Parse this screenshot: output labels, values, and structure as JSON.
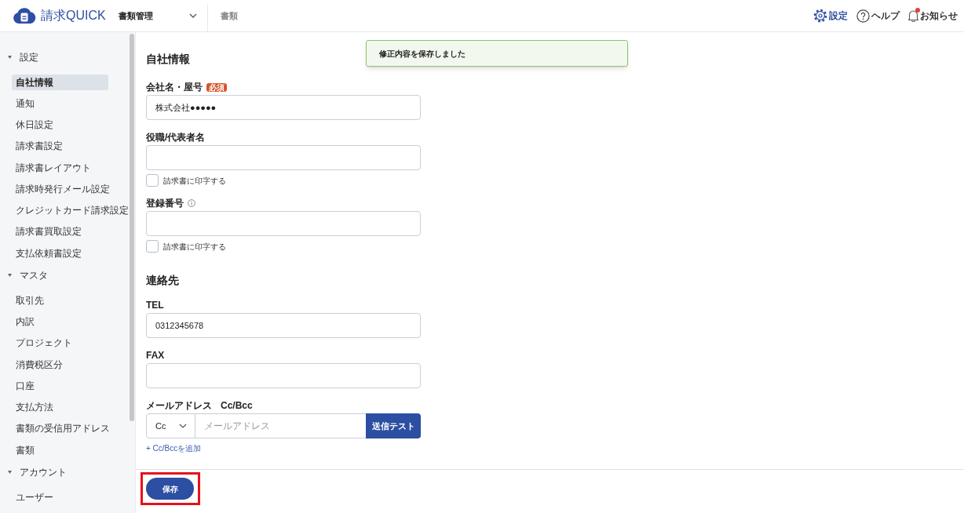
{
  "header": {
    "logo": "請求QUICK",
    "module_select": "書類管理",
    "breadcrumb": "書類",
    "actions": [
      {
        "kind": "settings",
        "label": "設定"
      },
      {
        "kind": "help",
        "label": "ヘルプ"
      },
      {
        "kind": "notifications",
        "label": "お知らせ",
        "unread": true
      }
    ]
  },
  "sidebar": {
    "groups": [
      {
        "label": "設定",
        "expanded": true,
        "items": [
          {
            "label": "自社情報",
            "selected": true
          },
          {
            "label": "通知",
            "selected": false
          },
          {
            "label": "休日設定",
            "selected": false
          },
          {
            "label": "請求書設定",
            "selected": false
          },
          {
            "label": "請求書レイアウト",
            "selected": false
          },
          {
            "label": "請求時発行メール設定",
            "selected": false
          },
          {
            "label": "クレジットカード請求設定",
            "selected": false
          },
          {
            "label": "請求書買取設定",
            "selected": false
          },
          {
            "label": "支払依頼書設定",
            "selected": false
          }
        ]
      },
      {
        "label": "マスタ",
        "expanded": true,
        "items": [
          {
            "label": "取引先",
            "selected": false
          },
          {
            "label": "内訳",
            "selected": false
          },
          {
            "label": "プロジェクト",
            "selected": false
          },
          {
            "label": "消費税区分",
            "selected": false
          },
          {
            "label": "口座",
            "selected": false
          },
          {
            "label": "支払方法",
            "selected": false
          },
          {
            "label": "書類の受信用アドレス",
            "selected": false
          },
          {
            "label": "書類",
            "selected": false
          }
        ]
      },
      {
        "label": "アカウント",
        "expanded": true,
        "items": [
          {
            "label": "ユーザー",
            "selected": false
          }
        ]
      }
    ]
  },
  "toast": {
    "message": "修正内容を保存しました"
  },
  "sections": [
    {
      "title": "自社情報",
      "fields": [
        {
          "kind": "text",
          "label": "会社名・屋号",
          "badge": "必須",
          "info": false,
          "value": "株式会社●●●●●"
        },
        {
          "kind": "text",
          "label": "役職/代表者名",
          "info": false,
          "print_option": {
            "label": "請求書に印字する",
            "checked": false
          }
        },
        {
          "kind": "text",
          "label": "登録番号",
          "info": true,
          "print_option": {
            "label": "請求書に印字する",
            "checked": false
          }
        }
      ]
    },
    {
      "title": "連絡先",
      "fields": [
        {
          "kind": "text",
          "label": "TEL",
          "info": false,
          "value": "0312345678"
        },
        {
          "kind": "text",
          "label": "FAX",
          "info": false
        },
        {
          "kind": "email",
          "label": "メールアドレス",
          "sublabel": "Cc/Bcc",
          "cc_select": "Cc",
          "placeholder": "メールアドレス",
          "test_button": "送信テスト",
          "add_link": "+ Cc/Bccを追加"
        }
      ]
    }
  ],
  "footer": {
    "save_button": {
      "label": "保存",
      "highlighted": true
    }
  }
}
